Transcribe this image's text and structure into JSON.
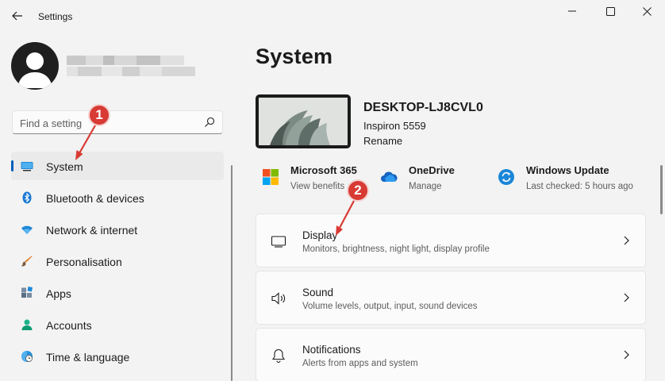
{
  "window": {
    "title": "Settings"
  },
  "user": {
    "name_redacted": true
  },
  "search": {
    "placeholder": "Find a setting"
  },
  "nav": {
    "items": [
      {
        "label": "System",
        "icon": "system-icon",
        "active": true
      },
      {
        "label": "Bluetooth & devices",
        "icon": "bluetooth-icon"
      },
      {
        "label": "Network & internet",
        "icon": "wifi-icon"
      },
      {
        "label": "Personalisation",
        "icon": "brush-icon"
      },
      {
        "label": "Apps",
        "icon": "apps-icon"
      },
      {
        "label": "Accounts",
        "icon": "account-icon"
      },
      {
        "label": "Time & language",
        "icon": "time-language-icon"
      }
    ]
  },
  "main": {
    "title": "System",
    "device": {
      "name": "DESKTOP-LJ8CVL0",
      "model": "Inspiron 5559",
      "rename_label": "Rename"
    },
    "quick": [
      {
        "title": "Microsoft 365",
        "subtitle": "View benefits",
        "icon": "microsoft-logo-icon"
      },
      {
        "title": "OneDrive",
        "subtitle": "Manage",
        "icon": "cloud-icon"
      },
      {
        "title": "Windows Update",
        "subtitle": "Last checked: 5 hours ago",
        "icon": "update-icon"
      }
    ],
    "cards": [
      {
        "title": "Display",
        "subtitle": "Monitors, brightness, night light, display profile",
        "icon": "monitor-icon"
      },
      {
        "title": "Sound",
        "subtitle": "Volume levels, output, input, sound devices",
        "icon": "speaker-icon"
      },
      {
        "title": "Notifications",
        "subtitle": "Alerts from apps and system",
        "icon": "bell-icon"
      }
    ]
  },
  "annotations": {
    "step1": "1",
    "step2": "2",
    "color": "#d83a34"
  },
  "colors": {
    "accent": "#005fb8",
    "background": "#f3f3f3",
    "card": "#fbfbfb"
  }
}
